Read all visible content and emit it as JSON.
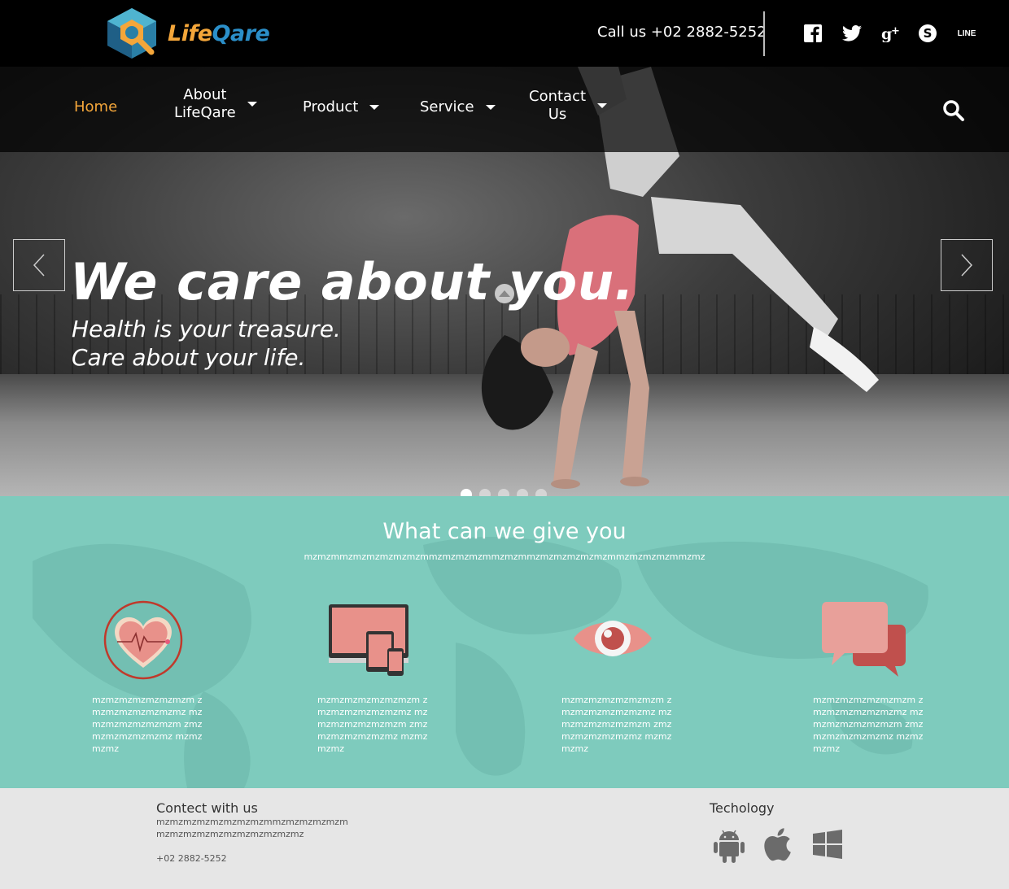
{
  "header": {
    "brand_part1": "Life",
    "brand_part2": "Qare",
    "phone_text": "Call us +02 2882-5252",
    "social": [
      "facebook-icon",
      "twitter-icon",
      "google-plus-icon",
      "skype-icon",
      "line-icon"
    ],
    "line_label": "LINE"
  },
  "nav": {
    "items": [
      {
        "label": "Home"
      },
      {
        "label": "About\nLifeQare"
      },
      {
        "label": "Product"
      },
      {
        "label": "Service"
      },
      {
        "label": "Contact\nUs"
      }
    ]
  },
  "hero": {
    "headline": "We  care about you.",
    "sub1": "Health is your treasure.",
    "sub2": "Care about your life.",
    "slide_count": 5,
    "active_slide": 1
  },
  "services": {
    "title": "What can we give you",
    "subtitle": "mzmzmmzmzmzmzmzmzmmzmzmzmzmmzmzmmzmzmzmzmzmzmmzmzmzmzmmzmz",
    "items": [
      {
        "icon": "heart-rate-icon",
        "text": "mzmzmzmzmzmzmzm zmzmzmzmzmzmzmz mzmzmzmzmzmzmzm zmzmzmzmzmzmzmz mzmzmzmz"
      },
      {
        "icon": "devices-icon",
        "text": "mzmzmzmzmzmzmzm zmzmzmzmzmzmzmz mzmzmzmzmzmzmzm zmzmzmzmzmzmzmz mzmzmzmz"
      },
      {
        "icon": "eye-icon",
        "text": "mzmzmzmzmzmzmzm zmzmzmzmzmzmzmz mzmzmzmzmzmzmzm zmzmzmzmzmzmzmz mzmzmzmz"
      },
      {
        "icon": "chat-bubbles-icon",
        "text": "mzmzmzmzmzmzmzm zmzmzmzmzmzmzmz mzmzmzmzmzmzmzm zmzmzmzmzmzmzmz mzmzmzmz"
      }
    ]
  },
  "footer": {
    "contact_title": "Contect with us",
    "contact_line1": "mzmzmzmzmzmzmzmzmmzmzmzmzmzm",
    "contact_line2": "mzmzmzmzmzmzmzmzmzmzmz",
    "phone": "+02 2882-5252",
    "tech_title": "Techology",
    "tech_icons": [
      "android-icon",
      "apple-icon",
      "windows-icon"
    ]
  },
  "colors": {
    "accent_orange": "#f4a63a",
    "brand_blue": "#2b8fc9",
    "teal": "#7ecbbd",
    "salmon": "#e8918a",
    "footer_bg": "#e6e6e6"
  }
}
